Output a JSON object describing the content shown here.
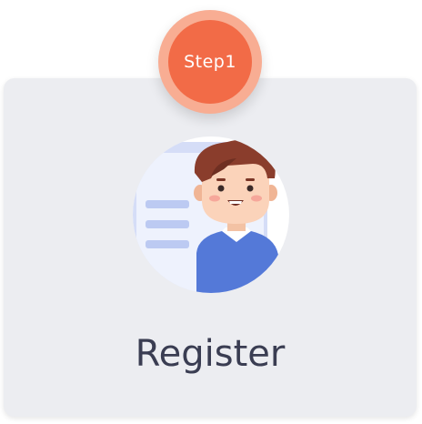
{
  "step_badge": {
    "label": "Step1",
    "color": "#f26b47",
    "ring_color": "#f8ad93"
  },
  "card": {
    "title": "Register",
    "background": "#ecedf1",
    "illustration": "user-avatar-icon"
  }
}
